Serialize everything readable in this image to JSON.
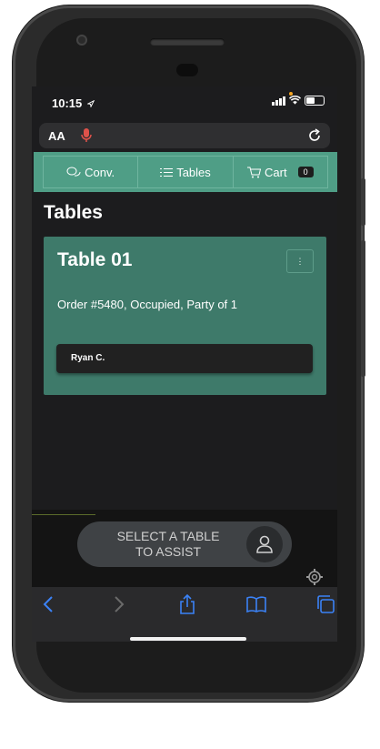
{
  "status_bar": {
    "time": "10:15"
  },
  "url_bar": {
    "text_size_label": "AA"
  },
  "nav": {
    "conv_label": "Conv.",
    "tables_label": "Tables",
    "cart_label": "Cart",
    "cart_count": "0"
  },
  "page": {
    "title": "Tables"
  },
  "tables": [
    {
      "name": "Table 01",
      "order_summary": "Order #5480, Occupied, Party of 1",
      "guest": "Ryan C."
    }
  ],
  "assist_button": {
    "line1": "SELECT A TABLE",
    "line2": "TO ASSIST"
  },
  "colors": {
    "nav_green": "#4f9e86",
    "card_green": "#3e7a6a",
    "ios_blue": "#3b82f6",
    "mic_red": "#e0524a"
  },
  "icons": [
    "location-arrow-icon",
    "signal-icon",
    "wifi-icon",
    "battery-icon",
    "microphone-icon",
    "reload-icon",
    "chat-icon",
    "list-icon",
    "cart-icon",
    "kebab-menu-icon",
    "user-icon",
    "settings-icon",
    "back-icon",
    "forward-icon",
    "share-icon",
    "bookmarks-icon",
    "tabs-icon"
  ]
}
